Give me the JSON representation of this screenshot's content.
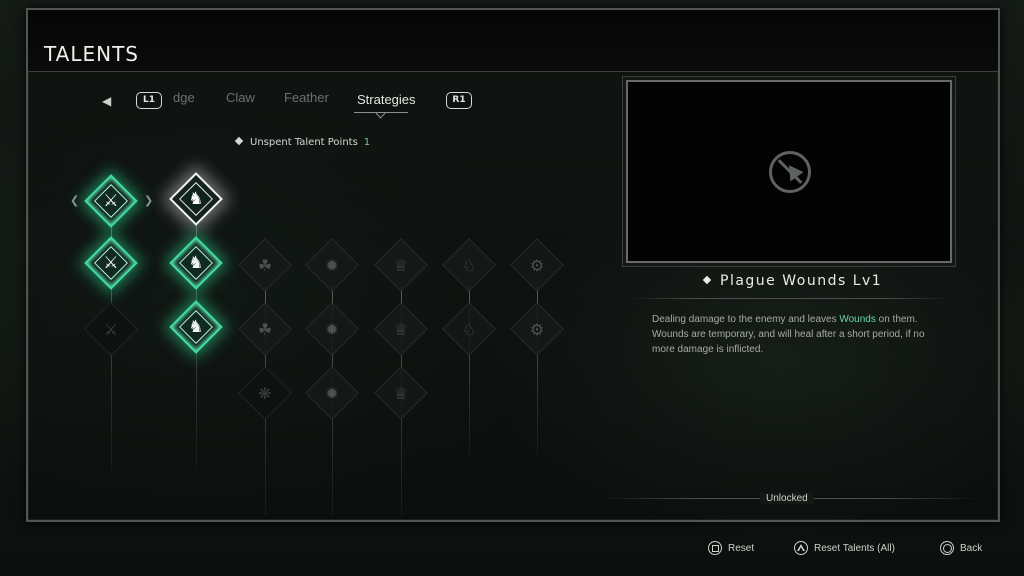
{
  "header": {
    "title": "TALENTS"
  },
  "tabs": {
    "prev_button": "L1",
    "next_button": "R1",
    "items": [
      {
        "label": "dge"
      },
      {
        "label": "Claw"
      },
      {
        "label": "Feather"
      },
      {
        "label": "Strategies",
        "active": true
      }
    ]
  },
  "talent_points": {
    "label": "Unspent Talent Points",
    "value": "1"
  },
  "tree": {
    "columns": [
      {
        "icon": "axe-icon",
        "nodes": [
          "lit",
          "lit",
          "locked"
        ]
      },
      {
        "icon": "warrior-icon",
        "nodes": [
          "selected",
          "lit",
          "lit"
        ]
      },
      {
        "icon": "hooded-figure-icon",
        "nodes": [
          "locked",
          "locked",
          "locked"
        ]
      },
      {
        "icon": "sun-burst-icon",
        "nodes": [
          "locked",
          "locked",
          "locked"
        ]
      },
      {
        "icon": "crown-icon",
        "nodes": [
          "locked",
          "locked",
          "locked"
        ]
      },
      {
        "icon": "dragon-head-icon",
        "nodes": [
          "locked",
          "locked"
        ]
      },
      {
        "icon": "staff-icon",
        "nodes": [
          "locked",
          "locked"
        ]
      }
    ]
  },
  "detail": {
    "name": "Plague Wounds Lv1",
    "description_parts": [
      "Dealing damage to the enemy and leaves ",
      "Wounds",
      " on them. Wounds are temporary, and will heal after a short period, if no more damage is inflicted."
    ],
    "status": "Unlocked",
    "preview_icon": "no-video-icon"
  },
  "footer": {
    "reset": "Reset",
    "reset_all": "Reset Talents (All)",
    "back": "Back"
  },
  "colors": {
    "accent": "#3fd9a2",
    "highlight": "#67d3a6"
  }
}
